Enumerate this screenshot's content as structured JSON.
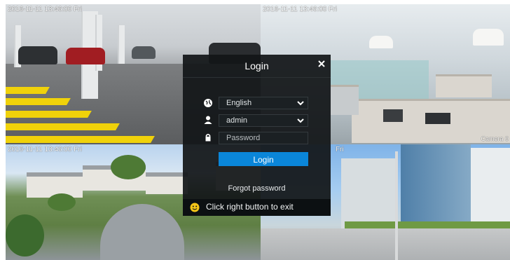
{
  "cameras": [
    {
      "timestamp": "2016-11-11 13:46:00 Fri",
      "name": ""
    },
    {
      "timestamp": "2016-11-11 13:46:00 Fri",
      "name": "Camera 0"
    },
    {
      "timestamp": "2016-11-11 13:46:00 Fri",
      "name": ""
    },
    {
      "timestamp": "Fri",
      "name": ""
    }
  ],
  "login": {
    "title": "Login",
    "language": "English",
    "username": "admin",
    "password_placeholder": "Password",
    "login_button": "Login",
    "forgot_password": "Forgot password",
    "exit_hint": "Click right button to exit"
  },
  "icons": {
    "close": "close-icon",
    "language": "globe-icon",
    "user": "user-icon",
    "password": "lock-icon",
    "dropdown": "chevron-down-icon",
    "exit": "smiley-icon"
  },
  "colors": {
    "dialog_bg": "#121618",
    "accent": "#0a86d9",
    "exit_icon": "#f5c518"
  }
}
